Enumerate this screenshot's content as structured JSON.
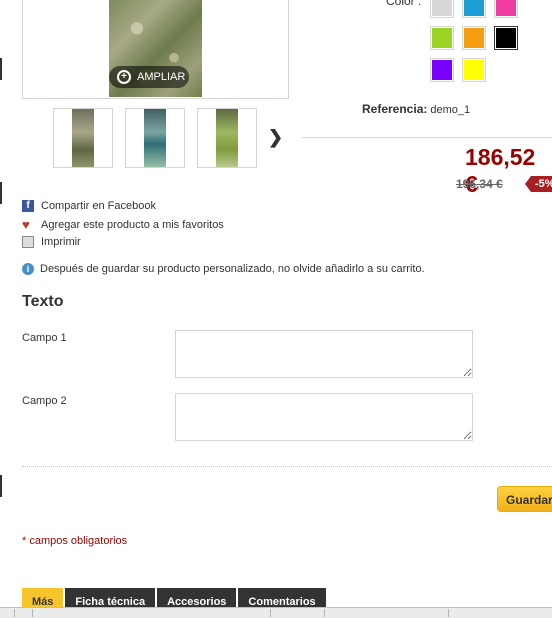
{
  "gallery": {
    "zoom_label": "AMPLIAR",
    "thumbnail_count": 3
  },
  "colors": {
    "label": "Color :",
    "swatches": [
      {
        "name": "gris claro",
        "hex": "#d8d8d8"
      },
      {
        "name": "azul",
        "hex": "#1a9ed4"
      },
      {
        "name": "rosa",
        "hex": "#f03ca2"
      },
      {
        "name": "verde",
        "hex": "#9ad526"
      },
      {
        "name": "naranja",
        "hex": "#f59e10"
      },
      {
        "name": "negro",
        "hex": "#000000",
        "selected": true
      },
      {
        "name": "violeta",
        "hex": "#7a00ff"
      },
      {
        "name": "amarillo",
        "hex": "#ffff00"
      }
    ]
  },
  "product": {
    "reference_label": "Referencia:",
    "reference_value": "demo_1",
    "price": "186,52 €",
    "old_price": "196,34 €",
    "discount": "-5%",
    "price_color": "#990000"
  },
  "actions": {
    "facebook": "Compartir en Facebook",
    "favorites": "Agregar este producto a mis favoritos",
    "print": "Imprimir"
  },
  "info_message": "Después de guardar su producto personalizado, no olvide añadirlo a su carrito.",
  "customization": {
    "title": "Texto",
    "fields": [
      {
        "label": "Campo 1",
        "value": ""
      },
      {
        "label": "Campo 2",
        "value": ""
      }
    ],
    "save_label": "Guardar",
    "required_note": "* campos obligatorios"
  },
  "tabs": [
    {
      "label": "Más",
      "active": true
    },
    {
      "label": "Ficha técnica",
      "active": false
    },
    {
      "label": "Accesorios",
      "active": false
    },
    {
      "label": "Comentarios",
      "active": false
    }
  ]
}
